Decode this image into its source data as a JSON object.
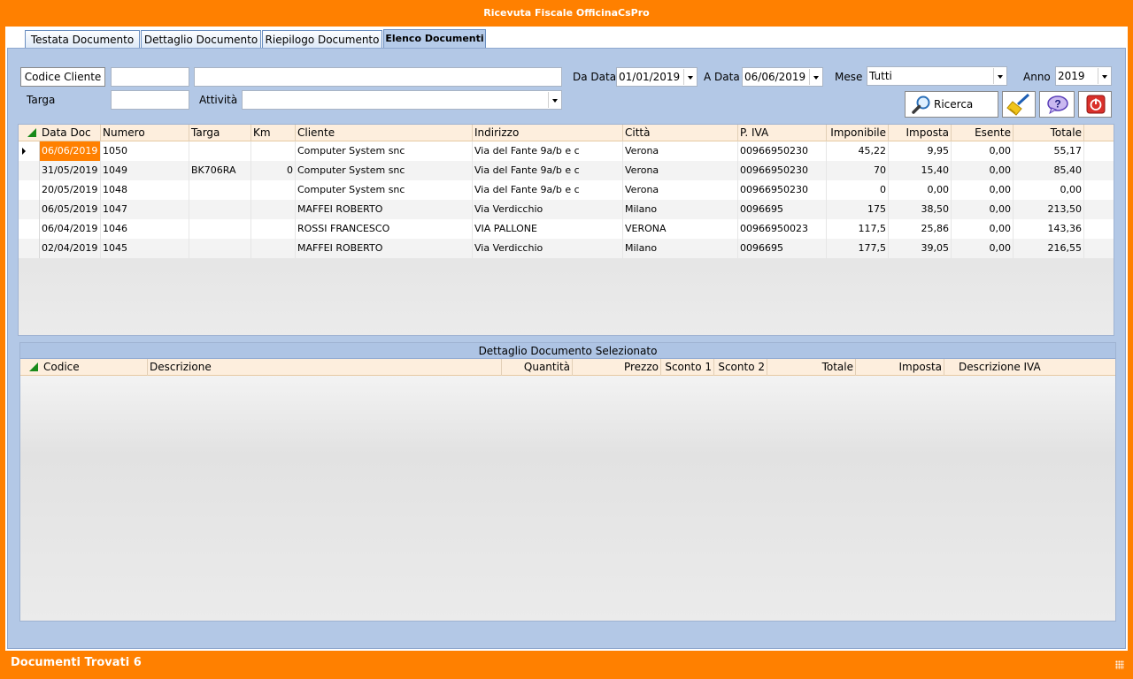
{
  "window": {
    "title": "Ricevuta Fiscale OfficinaCsPro"
  },
  "tabs": [
    {
      "label": "Testata Documento"
    },
    {
      "label": "Dettaglio Documento"
    },
    {
      "label": "Riepilogo Documento"
    },
    {
      "label": "Elenco Documenti"
    }
  ],
  "filters": {
    "codice_cliente_button": "Codice Cliente",
    "codice_cliente_value": "",
    "cliente_name_value": "",
    "targa_label": "Targa",
    "targa_value": "",
    "attivita_label": "Attività",
    "attivita_value": "",
    "da_data_label": "Da Data",
    "da_data_value": "01/01/2019",
    "a_data_label": "A Data",
    "a_data_value": "06/06/2019",
    "mese_label": "Mese",
    "mese_value": "Tutti",
    "anno_label": "Anno",
    "anno_value": "2019",
    "ricerca_button": "Ricerca"
  },
  "icons": {
    "search": "magnifier-icon",
    "clear": "broom-icon",
    "help": "help-question-icon",
    "exit": "power-icon"
  },
  "documents": {
    "columns": [
      "Data Doc",
      "Numero",
      "Targa",
      "Km",
      "Cliente",
      "Indirizzo",
      "Città",
      "P. IVA",
      "Imponibile",
      "Imposta",
      "Esente",
      "Totale"
    ],
    "rows": [
      [
        "06/06/2019",
        "1050",
        "",
        "",
        "Computer System snc",
        "Via del Fante 9a/b e c",
        "Verona",
        "00966950230",
        "45,22",
        "9,95",
        "0,00",
        "55,17"
      ],
      [
        "31/05/2019",
        "1049",
        "BK706RA",
        "0",
        "Computer System snc",
        "Via del Fante 9a/b e c",
        "Verona",
        "00966950230",
        "70",
        "15,40",
        "0,00",
        "85,40"
      ],
      [
        "20/05/2019",
        "1048",
        "",
        "",
        "Computer System snc",
        "Via del Fante 9a/b e c",
        "Verona",
        "00966950230",
        "0",
        "0,00",
        "0,00",
        "0,00"
      ],
      [
        "06/05/2019",
        "1047",
        "",
        "",
        "MAFFEI ROBERTO",
        "Via Verdicchio",
        "Milano",
        "0096695",
        "175",
        "38,50",
        "0,00",
        "213,50"
      ],
      [
        "06/04/2019",
        "1046",
        "",
        "",
        "ROSSI FRANCESCO",
        "VIA PALLONE",
        "VERONA",
        "00966950023",
        "117,5",
        "25,86",
        "0,00",
        "143,36"
      ],
      [
        "02/04/2019",
        "1045",
        "",
        "",
        "MAFFEI ROBERTO",
        "Via Verdicchio",
        "Milano",
        "0096695",
        "177,5",
        "39,05",
        "0,00",
        "216,55"
      ]
    ]
  },
  "detail": {
    "caption": "Dettaglio Documento Selezionato",
    "columns": [
      "Codice",
      "Descrizione",
      "Quantità",
      "Prezzo",
      "Sconto 1",
      "Sconto 2",
      "Totale",
      "Imposta",
      "Descrizione IVA"
    ]
  },
  "status": {
    "text": "Documenti Trovati 6"
  },
  "colors": {
    "accent": "#ff8000",
    "panel": "#b3c8e6",
    "header": "#fdeedd"
  }
}
